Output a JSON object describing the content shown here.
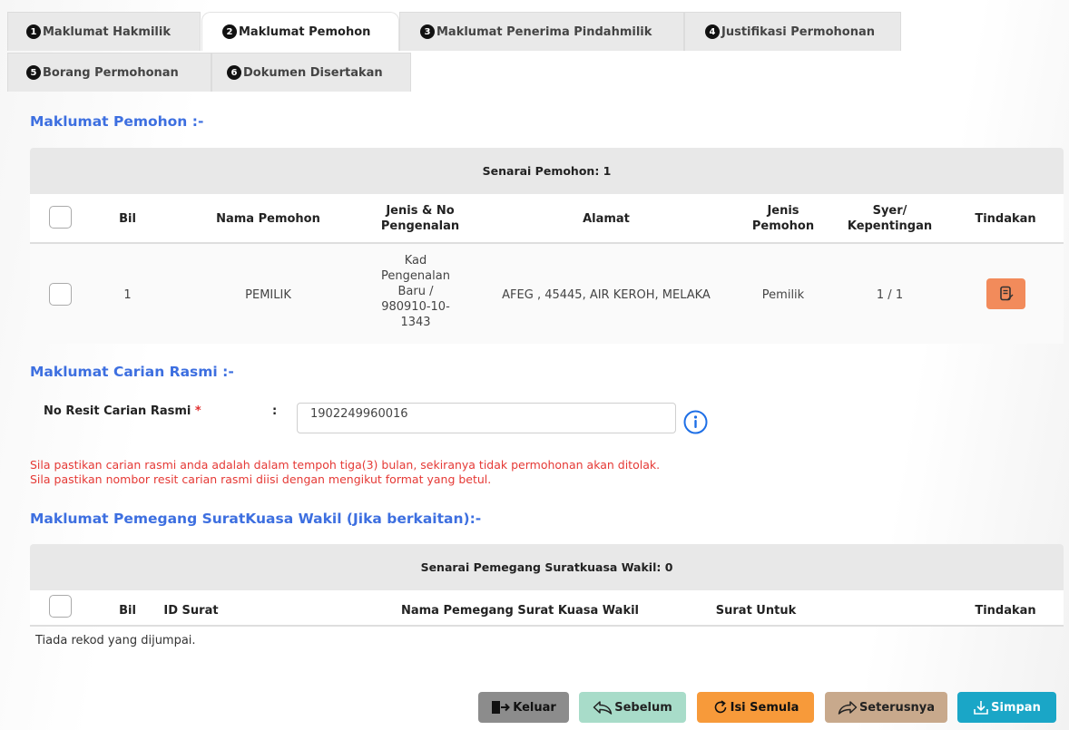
{
  "tabs": [
    {
      "num": "1",
      "label": "Maklumat Hakmilik"
    },
    {
      "num": "2",
      "label": "Maklumat Pemohon"
    },
    {
      "num": "3",
      "label": "Maklumat Penerima Pindahmilik"
    },
    {
      "num": "4",
      "label": "Justifikasi Permohonan"
    },
    {
      "num": "5",
      "label": "Borang Permohonan"
    },
    {
      "num": "6",
      "label": "Dokumen Disertakan"
    }
  ],
  "pemohon": {
    "title": "Maklumat Pemohon :-",
    "table_title": "Senarai Pemohon: 1",
    "columns": [
      "Bil",
      "Nama Pemohon",
      "Jenis & No Pengenalan",
      "Alamat",
      "Jenis Pemohon",
      "Syer/ Kepentingan",
      "Tindakan"
    ],
    "rows": [
      {
        "bil": "1",
        "nama": "PEMILIK",
        "pengenalan": "Kad Pengenalan Baru / 980910-10-1343",
        "alamat": "AFEG , 45445, AIR KEROH, MELAKA",
        "jenis": "Pemilik",
        "syer": "1 / 1"
      }
    ]
  },
  "carian": {
    "title": "Maklumat Carian Rasmi :-",
    "label": "No Resit Carian Rasmi",
    "required_mark": "*",
    "colon": ":",
    "value": "1902249960016",
    "warnings": [
      "Sila pastikan carian rasmi anda adalah dalam tempoh tiga(3) bulan, sekiranya tidak permohonan akan ditolak.",
      "Sila pastikan nombor resit carian rasmi diisi dengan mengikut format yang betul."
    ]
  },
  "wakil": {
    "title": "Maklumat Pemegang SuratKuasa Wakil (Jika berkaitan):-",
    "table_title": "Senarai Pemegang Suratkuasa Wakil: 0",
    "columns": [
      "Bil",
      "ID Surat",
      "Nama Pemegang Surat Kuasa Wakil",
      "Surat Untuk",
      "Tindakan"
    ],
    "empty": "Tiada rekod yang dijumpai."
  },
  "buttons": {
    "keluar": "Keluar",
    "sebelum": "Sebelum",
    "isi_semula": "Isi Semula",
    "seterusnya": "Seterusnya",
    "simpan": "Simpan"
  },
  "colors": {
    "accent_title": "#3d6fe0",
    "warning": "#e53935",
    "edit": "#f28b5b",
    "keluar": "#8c8c8c",
    "sebelum": "#a8dcc9",
    "isi_semula": "#f79a3a",
    "seterusnya": "#c8a98c",
    "simpan": "#1aa6c7"
  }
}
